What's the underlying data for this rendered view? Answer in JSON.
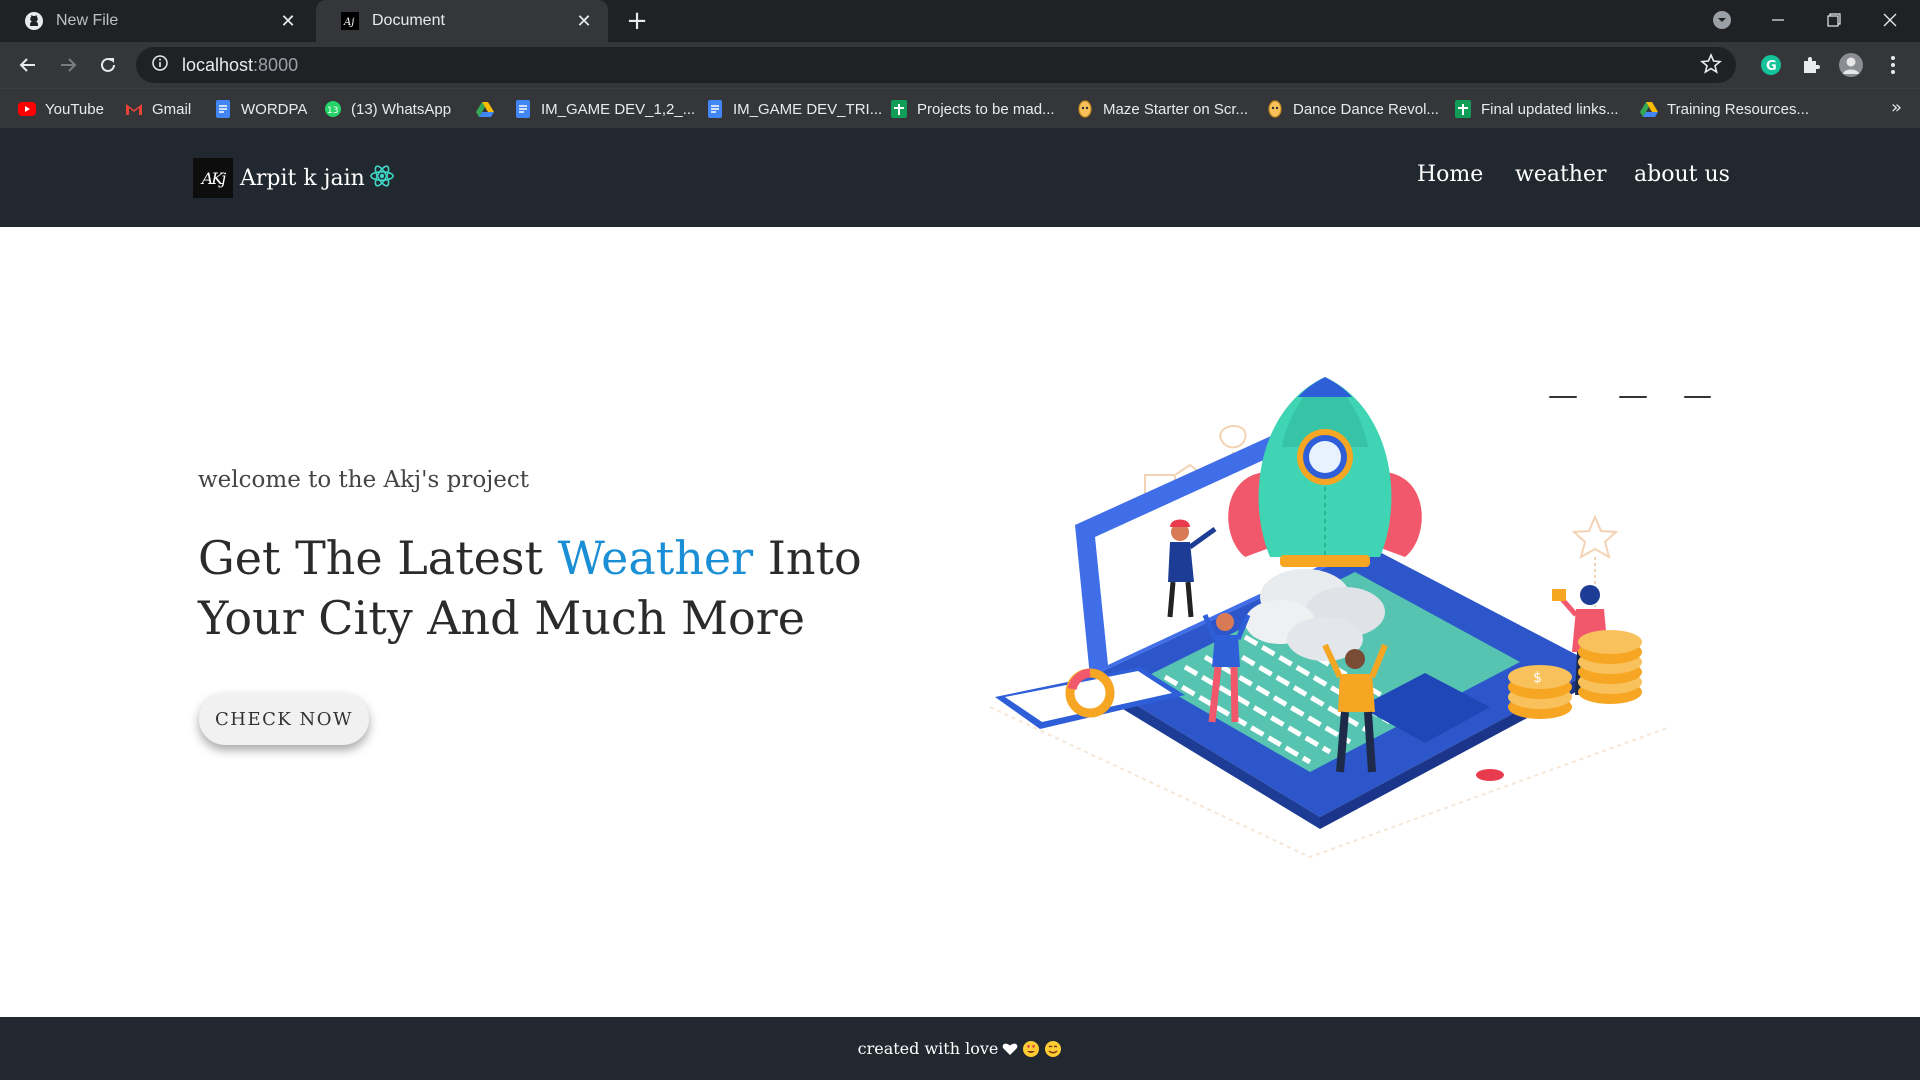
{
  "browser": {
    "tabs": [
      {
        "title": "New File",
        "icon": "github-icon",
        "active": false
      },
      {
        "title": "Document",
        "icon": "akj-favicon",
        "active": true
      }
    ],
    "address": {
      "host": "localhost",
      "port": ":8000"
    },
    "bookmarks": [
      {
        "label": "YouTube",
        "icon": "youtube-icon"
      },
      {
        "label": "Gmail",
        "icon": "gmail-icon"
      },
      {
        "label": "WORDPA",
        "icon": "docs-icon"
      },
      {
        "label": "(13) WhatsApp",
        "icon": "whatsapp-icon"
      },
      {
        "label": "",
        "icon": "drive-icon"
      },
      {
        "label": "IM_GAME DEV_1,2_...",
        "icon": "docs-icon"
      },
      {
        "label": "IM_GAME DEV_TRI...",
        "icon": "docs-icon"
      },
      {
        "label": "Projects to be mad...",
        "icon": "sheets-icon"
      },
      {
        "label": "Maze Starter on Scr...",
        "icon": "scratch-icon"
      },
      {
        "label": "Dance Dance Revol...",
        "icon": "scratch-icon"
      },
      {
        "label": "Final updated links...",
        "icon": "sheets-icon"
      },
      {
        "label": "Training Resources...",
        "icon": "drive-icon"
      }
    ],
    "overflow_label": "»"
  },
  "site": {
    "brand": {
      "logo_text": "AKj",
      "name": "Arpit k jain"
    },
    "nav": [
      "Home",
      "weather",
      "about us"
    ],
    "hero": {
      "welcome": "welcome to the Akj's project",
      "headline_before": "Get The Latest ",
      "headline_accent": "Weather",
      "headline_after": " Into Your City And Much More",
      "cta_label": "CHECK NOW"
    },
    "footer": {
      "text": "created with love"
    }
  },
  "colors": {
    "nav_bg": "#212830",
    "accent": "#1a8fd6",
    "chrome_bg": "#202124"
  }
}
